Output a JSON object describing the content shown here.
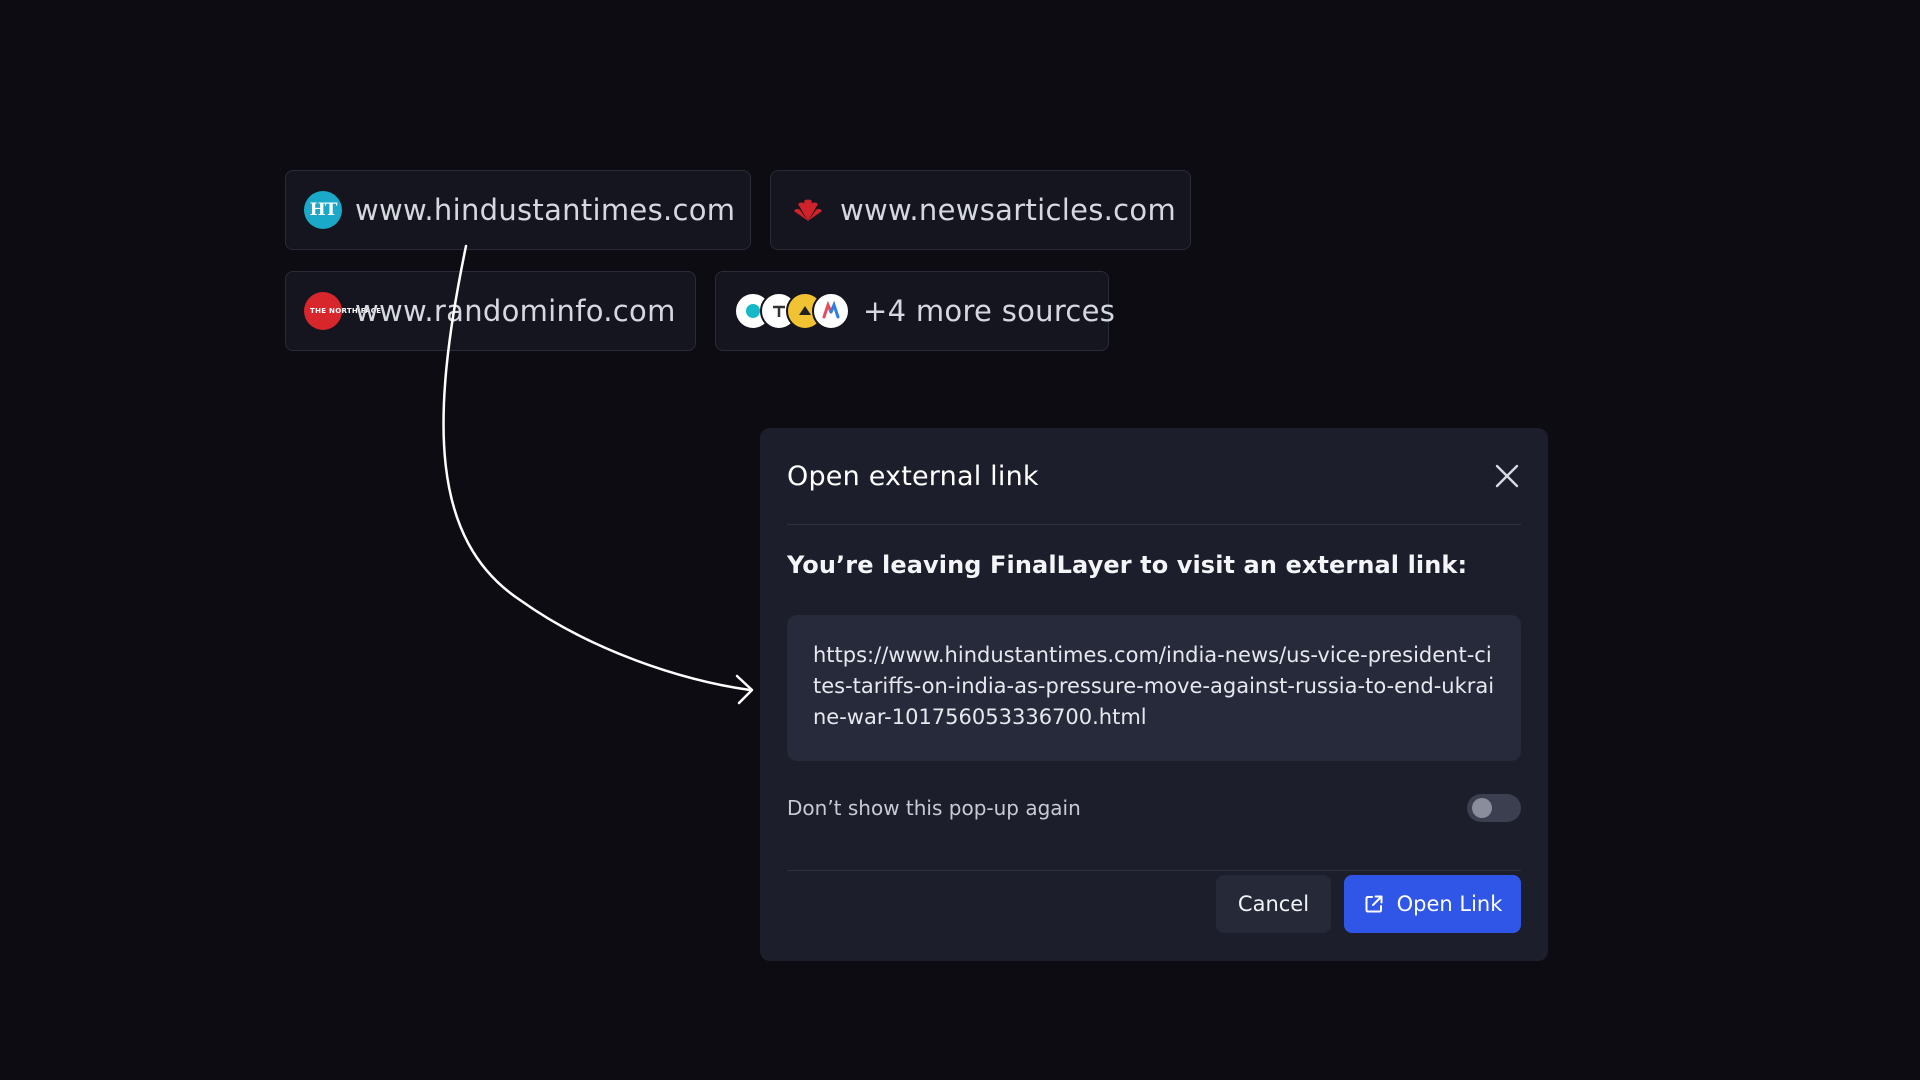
{
  "sources": {
    "items": [
      {
        "label": "www.hindustantimes.com",
        "icon": "hindustan-times-logo",
        "icon_text": "HT"
      },
      {
        "label": "www.newsarticles.com",
        "icon": "huawei-style-logo"
      },
      {
        "label": "www.randominfo.com",
        "icon": "north-face-logo",
        "icon_text": "THE NORTH FACE"
      },
      {
        "label": "+4 more sources",
        "icon": "stacked-source-logos"
      }
    ]
  },
  "dialog": {
    "title": "Open external link",
    "subtitle": "You’re leaving FinalLayer to visit an external link:",
    "url": "https://www.hindustantimes.com/india-news/us-vice-president-cites-tariffs-on-india-as-pressure-move-against-russia-to-end-ukraine-war-101756053336700.html",
    "toggle_label": "Don’t show this pop-up again",
    "toggle_on": false,
    "cancel_label": "Cancel",
    "open_label": "Open Link"
  },
  "colors": {
    "background": "#0c0c12",
    "dialog": "#1c1e2b",
    "primary": "#2f56e6",
    "chip": "#14151e"
  }
}
